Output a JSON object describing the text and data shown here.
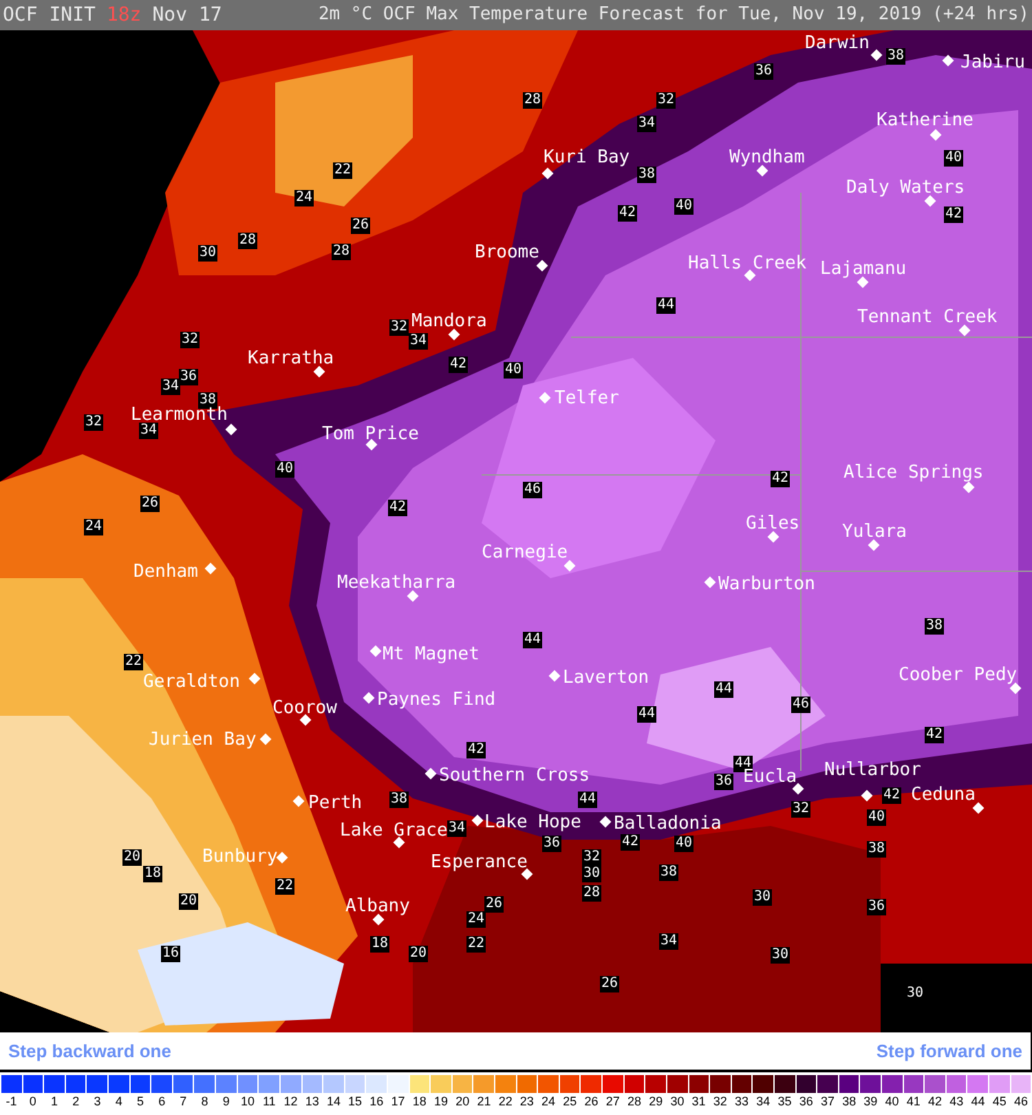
{
  "header": {
    "left": "OCF INIT",
    "run": "18z",
    "date": "Nov 17",
    "title": "2m °C OCF Max Temperature Forecast for Tue, Nov 19, 2019 (+24 hrs)"
  },
  "map": {
    "cities": [
      {
        "name": "Darwin"
      },
      {
        "name": "Jabiru"
      },
      {
        "name": "Katherine"
      },
      {
        "name": "Kuri Bay"
      },
      {
        "name": "Wyndham"
      },
      {
        "name": "Daly Waters"
      },
      {
        "name": "Broome"
      },
      {
        "name": "Halls Creek"
      },
      {
        "name": "Lajamanu"
      },
      {
        "name": "Mandora"
      },
      {
        "name": "Tennant Creek"
      },
      {
        "name": "Karratha"
      },
      {
        "name": "Telfer"
      },
      {
        "name": "Learmonth"
      },
      {
        "name": "Tom Price"
      },
      {
        "name": "Alice Springs"
      },
      {
        "name": "Giles"
      },
      {
        "name": "Yulara"
      },
      {
        "name": "Carnegie"
      },
      {
        "name": "Denham"
      },
      {
        "name": "Meekatharra"
      },
      {
        "name": "Warburton"
      },
      {
        "name": "Mt Magnet"
      },
      {
        "name": "Geraldton"
      },
      {
        "name": "Laverton"
      },
      {
        "name": "Coober Pedy"
      },
      {
        "name": "Coorow"
      },
      {
        "name": "Paynes Find"
      },
      {
        "name": "Jurien Bay"
      },
      {
        "name": "Southern Cross"
      },
      {
        "name": "Nullarbor"
      },
      {
        "name": "Eucla"
      },
      {
        "name": "Ceduna"
      },
      {
        "name": "Perth"
      },
      {
        "name": "Lake Grace"
      },
      {
        "name": "Lake Hope"
      },
      {
        "name": "Balladonia"
      },
      {
        "name": "Bunbury"
      },
      {
        "name": "Esperance"
      },
      {
        "name": "Albany"
      }
    ],
    "contour_labels": [
      "28",
      "32",
      "36",
      "38",
      "40",
      "22",
      "24",
      "26",
      "30",
      "28",
      "28",
      "34",
      "38",
      "42",
      "40",
      "42",
      "44",
      "32",
      "32",
      "34",
      "36",
      "34",
      "38",
      "42",
      "40",
      "32",
      "34",
      "40",
      "26",
      "42",
      "46",
      "42",
      "24",
      "38",
      "22",
      "44",
      "44",
      "46",
      "44",
      "42",
      "42",
      "36",
      "44",
      "42",
      "32",
      "40",
      "38",
      "34",
      "44",
      "36",
      "42",
      "40",
      "38",
      "32",
      "30",
      "28",
      "38",
      "22",
      "20",
      "18",
      "20",
      "26",
      "24",
      "18",
      "20",
      "22",
      "16",
      "30",
      "36",
      "34",
      "30",
      "26",
      "30"
    ]
  },
  "nav": {
    "back": "Step backward one",
    "forward": "Step forward one"
  },
  "legend": [
    {
      "label": "-1",
      "color": "#0a32ff"
    },
    {
      "label": "0",
      "color": "#0a32ff"
    },
    {
      "label": "1",
      "color": "#0a34ff"
    },
    {
      "label": "2",
      "color": "#0a36ff"
    },
    {
      "label": "3",
      "color": "#0a38ff"
    },
    {
      "label": "4",
      "color": "#0a3aff"
    },
    {
      "label": "5",
      "color": "#0c3cff"
    },
    {
      "label": "6",
      "color": "#1a48ff"
    },
    {
      "label": "7",
      "color": "#3060ff"
    },
    {
      "label": "8",
      "color": "#4470ff"
    },
    {
      "label": "9",
      "color": "#5c82ff"
    },
    {
      "label": "10",
      "color": "#7090ff"
    },
    {
      "label": "11",
      "color": "#80a0ff"
    },
    {
      "label": "12",
      "color": "#90aaff"
    },
    {
      "label": "13",
      "color": "#a4baff"
    },
    {
      "label": "14",
      "color": "#b4c8ff"
    },
    {
      "label": "15",
      "color": "#c8d6ff"
    },
    {
      "label": "16",
      "color": "#dce8ff"
    },
    {
      "label": "17",
      "color": "#f0f6ff"
    },
    {
      "label": "18",
      "color": "#fce47a"
    },
    {
      "label": "19",
      "color": "#f9cc5a"
    },
    {
      "label": "20",
      "color": "#f7b444"
    },
    {
      "label": "21",
      "color": "#f59a2a"
    },
    {
      "label": "22",
      "color": "#f4820e"
    },
    {
      "label": "23",
      "color": "#f06a00"
    },
    {
      "label": "24",
      "color": "#f25500"
    },
    {
      "label": "25",
      "color": "#f04000"
    },
    {
      "label": "26",
      "color": "#ef2a00"
    },
    {
      "label": "27",
      "color": "#e80a00"
    },
    {
      "label": "28",
      "color": "#d00000"
    },
    {
      "label": "29",
      "color": "#b80000"
    },
    {
      "label": "30",
      "color": "#a00000"
    },
    {
      "label": "31",
      "color": "#8c0000"
    },
    {
      "label": "32",
      "color": "#780000"
    },
    {
      "label": "33",
      "color": "#640000"
    },
    {
      "label": "34",
      "color": "#500000"
    },
    {
      "label": "35",
      "color": "#3c0010"
    },
    {
      "label": "36",
      "color": "#32002e"
    },
    {
      "label": "37",
      "color": "#460050"
    },
    {
      "label": "38",
      "color": "#5a0080"
    },
    {
      "label": "39",
      "color": "#6e109a"
    },
    {
      "label": "40",
      "color": "#8420ae"
    },
    {
      "label": "41",
      "color": "#9838c0"
    },
    {
      "label": "42",
      "color": "#aa50cc"
    },
    {
      "label": "43",
      "color": "#c060e0"
    },
    {
      "label": "44",
      "color": "#d478f2"
    },
    {
      "label": "45",
      "color": "#e09cf6"
    },
    {
      "label": "46",
      "color": "#e8b4f8"
    }
  ]
}
